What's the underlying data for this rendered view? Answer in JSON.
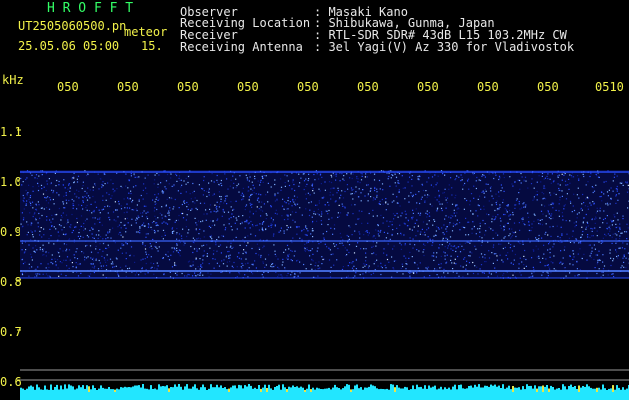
{
  "header": {
    "program": "H R O F F T",
    "filename": "UT2505060500.pn",
    "type": "meteor",
    "timestamp": "25.05.06 05:00",
    "interval": "15.",
    "labels": [
      "Observer",
      "Receiving Location",
      "Receiver",
      "Receiving Antenna"
    ],
    "values": [
      ": Masaki Kano",
      ": Shibukawa, Gunma, Japan",
      ": RTL-SDR SDR# 43dB L15 103.2MHz CW",
      ": 3el Yagi(V) Az 330 for Vladivostok"
    ]
  },
  "axis": {
    "unit": "kHz",
    "time_ticks": [
      "050",
      "050",
      "050",
      "050",
      "050",
      "050",
      "050",
      "050",
      "050",
      "0510"
    ],
    "freq_ticks": [
      "1.1",
      "1.0",
      "0.9",
      "0.8",
      "0.7",
      "0.6"
    ]
  },
  "colors": {
    "title": "#33ff66",
    "text": "#f2f24a",
    "noise": "#1a3cff",
    "baseline": "#22e6ff"
  }
}
